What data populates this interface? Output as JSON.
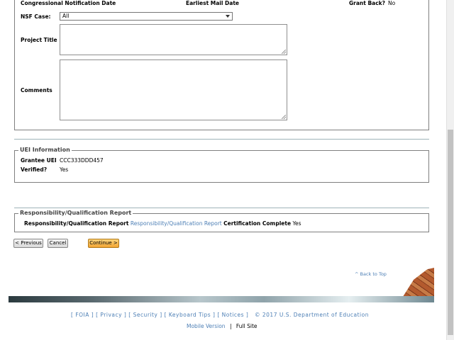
{
  "top_row": {
    "congressional_label": "Congressional Notification Date",
    "earliest_label": "Earliest Mail Date",
    "grant_back_label": "Grant Back?",
    "grant_back_value": "No"
  },
  "form": {
    "nsf_case_label": "NSF Case:",
    "nsf_case_value": "All",
    "project_title_label": "Project Title",
    "comments_label": "Comments"
  },
  "uei": {
    "legend": "UEI Information",
    "grantee_label": "Grantee UEI",
    "grantee_value": "CCC333DDD457",
    "verified_label": "Verified?",
    "verified_value": "Yes"
  },
  "responsibility": {
    "legend": "Responsibility/Qualification Report",
    "report_label": "Responsibility/Qualification Report",
    "report_link": "Responsibility/Qualification Report",
    "cert_label": "Certification Complete",
    "cert_value": "Yes"
  },
  "buttons": {
    "previous": "< Previous",
    "cancel": "Cancel",
    "continue": "Continue >"
  },
  "back_to_top": "^ Back to Top",
  "footer": {
    "foia": "FOIA",
    "privacy": "Privacy",
    "security": "Security",
    "keyboard": "Keyboard Tips",
    "notices": "Notices",
    "copyright": "©  2017  U.S.  Department  of  Education",
    "mobile": "Mobile  Version",
    "separator": "|",
    "full_site": "Full  Site"
  }
}
